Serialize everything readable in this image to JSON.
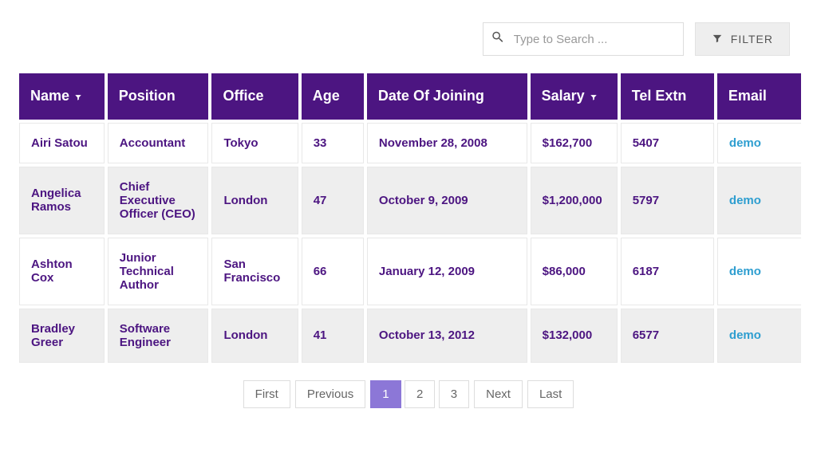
{
  "toolbar": {
    "search_placeholder": "Type to Search ...",
    "filter_label": "FILTER"
  },
  "table": {
    "columns": [
      {
        "key": "name",
        "label": "Name",
        "filter": true
      },
      {
        "key": "pos",
        "label": "Position",
        "filter": false
      },
      {
        "key": "office",
        "label": "Office",
        "filter": false
      },
      {
        "key": "age",
        "label": "Age",
        "filter": false
      },
      {
        "key": "doj",
        "label": "Date Of Joining",
        "filter": false
      },
      {
        "key": "salary",
        "label": "Salary",
        "filter": true
      },
      {
        "key": "tel",
        "label": "Tel Extn",
        "filter": false
      },
      {
        "key": "email",
        "label": "Email",
        "filter": false
      }
    ],
    "rows": [
      {
        "name": "Airi Satou",
        "pos": "Accountant",
        "office": "Tokyo",
        "age": "33",
        "doj": "November 28, 2008",
        "salary": "$162,700",
        "tel": "5407",
        "email": "demo"
      },
      {
        "name": "Angelica Ramos",
        "pos": "Chief Executive Officer (CEO)",
        "office": "London",
        "age": "47",
        "doj": "October 9, 2009",
        "salary": "$1,200,000",
        "tel": "5797",
        "email": "demo"
      },
      {
        "name": "Ashton Cox",
        "pos": "Junior Technical Author",
        "office": "San Francisco",
        "age": "66",
        "doj": "January 12, 2009",
        "salary": "$86,000",
        "tel": "6187",
        "email": "demo"
      },
      {
        "name": "Bradley Greer",
        "pos": "Software Engineer",
        "office": "London",
        "age": "41",
        "doj": "October 13, 2012",
        "salary": "$132,000",
        "tel": "6577",
        "email": "demo"
      }
    ]
  },
  "pager": {
    "first": "First",
    "previous": "Previous",
    "pages": [
      "1",
      "2",
      "3"
    ],
    "active_page": "1",
    "next": "Next",
    "last": "Last"
  }
}
